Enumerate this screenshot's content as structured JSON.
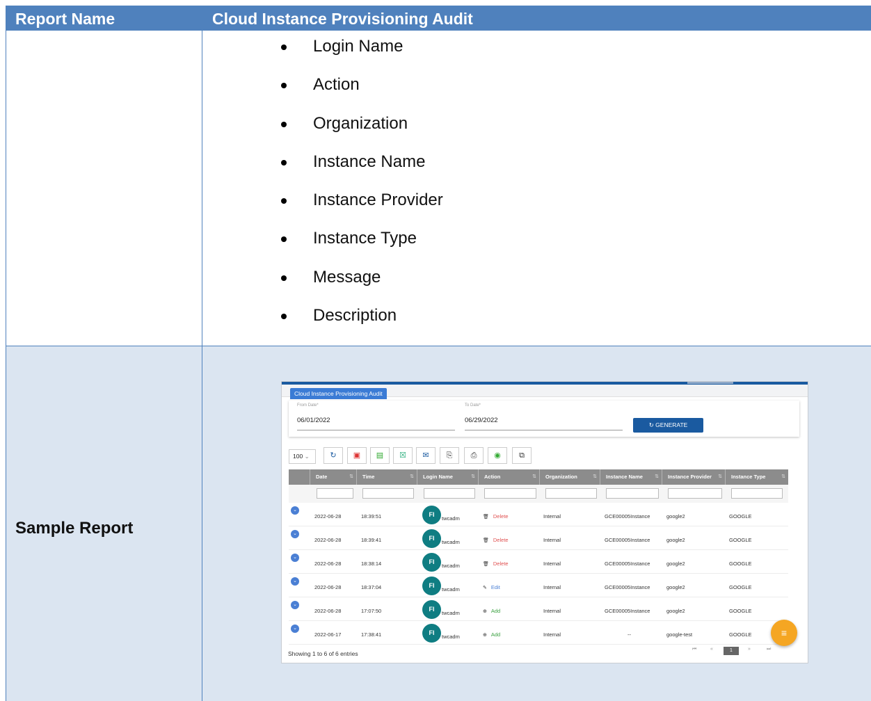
{
  "header": {
    "col1": "Report Name",
    "col2": "Cloud Instance Provisioning Audit"
  },
  "fields": [
    "Login Name",
    "Action",
    "Organization",
    "Instance Name",
    "Instance Provider",
    "Instance Type",
    "Message",
    "Description"
  ],
  "sample_label": "Sample Report",
  "screenshot": {
    "tab": "Cloud Instance Provisioning Audit",
    "from_label": "From Date*",
    "from_value": "06/01/2022",
    "to_label": "To Date*",
    "to_value": "06/29/2022",
    "generate": "GENERATE",
    "page_size": "100",
    "toolbar_icons": [
      "refresh-icon",
      "pdf-icon",
      "document-icon",
      "excel-icon",
      "email-icon",
      "copy-icon",
      "print-icon",
      "visibility-icon",
      "columns-icon"
    ],
    "columns": [
      "Date",
      "Time",
      "Login Name",
      "Action",
      "Organization",
      "Instance Name",
      "Instance Provider",
      "Instance Type"
    ],
    "rows": [
      {
        "date": "2022-06-28",
        "time": "18:39:51",
        "avatar": "FI",
        "login": "twcadm",
        "action": "Delete",
        "org": "Internal",
        "instance": "GCE00005Instance",
        "provider": "google2",
        "type": "GOOGLE"
      },
      {
        "date": "2022-06-28",
        "time": "18:39:41",
        "avatar": "FI",
        "login": "twcadm",
        "action": "Delete",
        "org": "Internal",
        "instance": "GCE00005Instance",
        "provider": "google2",
        "type": "GOOGLE"
      },
      {
        "date": "2022-06-28",
        "time": "18:38:14",
        "avatar": "FI",
        "login": "twcadm",
        "action": "Delete",
        "org": "Internal",
        "instance": "GCE00005Instance",
        "provider": "google2",
        "type": "GOOGLE"
      },
      {
        "date": "2022-06-28",
        "time": "18:37:04",
        "avatar": "FI",
        "login": "twcadm",
        "action": "Edit",
        "org": "Internal",
        "instance": "GCE00005Instance",
        "provider": "google2",
        "type": "GOOGLE"
      },
      {
        "date": "2022-06-28",
        "time": "17:07:50",
        "avatar": "FI",
        "login": "twcadm",
        "action": "Add",
        "org": "Internal",
        "instance": "GCE00005Instance",
        "provider": "google2",
        "type": "GOOGLE"
      },
      {
        "date": "2022-06-17",
        "time": "17:38:41",
        "avatar": "FI",
        "login": "twcadm",
        "action": "Add",
        "org": "Internal",
        "instance": "--",
        "provider": "google-test",
        "type": "GOOGLE"
      }
    ],
    "footer": "Showing 1 to 6 of 6 entries",
    "current_page": "1",
    "action_colors": {
      "Delete": "#e05050",
      "Edit": "#4a7fd4",
      "Add": "#3aa040"
    }
  }
}
